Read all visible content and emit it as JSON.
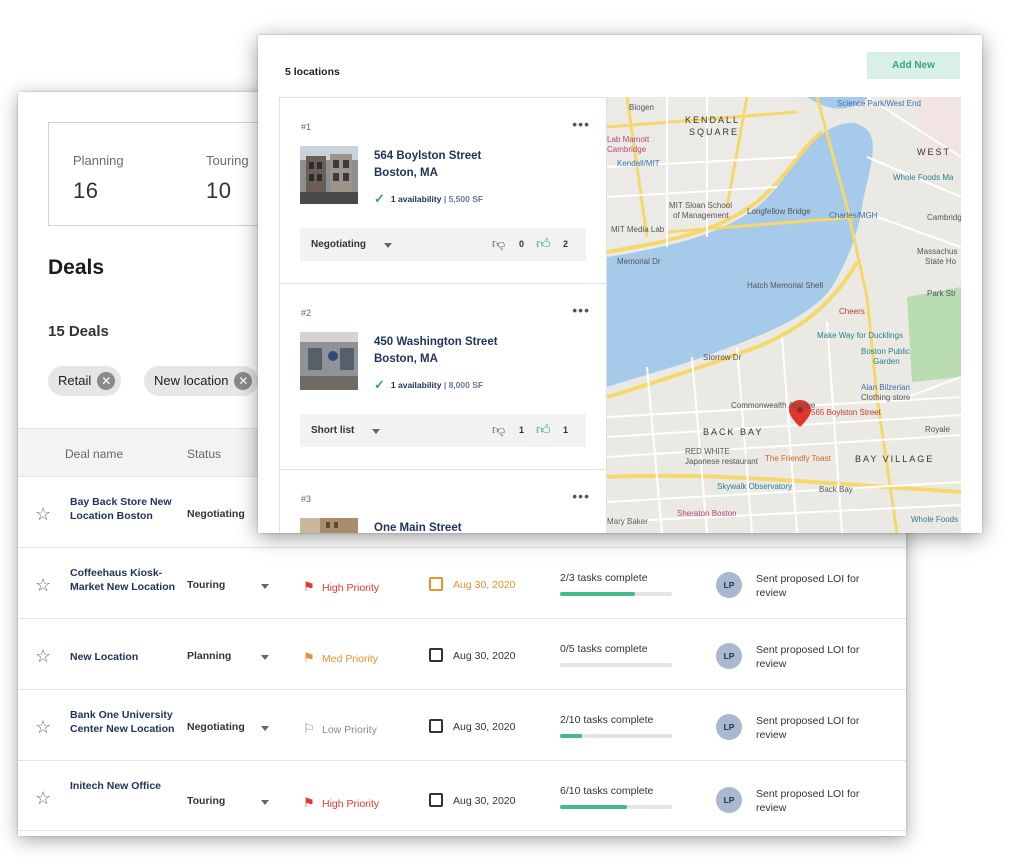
{
  "stats": [
    {
      "label": "Planning",
      "value": "16"
    },
    {
      "label": "Touring",
      "value": "10"
    }
  ],
  "deals": {
    "title": "Deals",
    "count": "15 Deals",
    "filters": [
      "Retail",
      "New location"
    ],
    "columns": {
      "name": "Deal name",
      "status": "Status"
    },
    "rows": [
      {
        "name": "Bay Back Store New Location Boston",
        "status": "Negotiating",
        "priority": "",
        "date": "",
        "tasks": "",
        "progress": 0,
        "assignee": "",
        "note": ""
      },
      {
        "name": "Coffeehaus Kiosk- Market New Location",
        "status": "Touring",
        "priority": "High Priority",
        "priority_color": "#e03a2f",
        "date": "Aug 30, 2020",
        "date_style": "orange",
        "tasks": "2/3 tasks complete",
        "progress": 0.667,
        "assignee": "LP",
        "note": "Sent proposed LOI for review"
      },
      {
        "name": "New Location",
        "status": "Planning",
        "priority": "Med Priority",
        "priority_color": "#e8922b",
        "date": "Aug 30, 2020",
        "date_style": "",
        "tasks": "0/5 tasks complete",
        "progress": 0,
        "assignee": "LP",
        "note": "Sent proposed LOI for review"
      },
      {
        "name": "Bank One University Center New Location",
        "status": "Negotiating",
        "priority": "Low Priority",
        "priority_color": "#8a8a8a",
        "date": "Aug 30, 2020",
        "date_style": "",
        "tasks": "2/10 tasks complete",
        "progress": 0.2,
        "assignee": "LP",
        "note": "Sent proposed LOI for review"
      },
      {
        "name": "Initech New Office",
        "status": "Touring",
        "priority": "High Priority",
        "priority_color": "#e03a2f",
        "date": "Aug 30, 2020",
        "date_style": "",
        "tasks": "6/10 tasks complete",
        "progress": 0.6,
        "assignee": "LP",
        "note": "Sent proposed LOI for review"
      }
    ]
  },
  "locations": {
    "count": "5 locations",
    "add_label": "Add New",
    "items": [
      {
        "index": "#1",
        "street": "564 Boylston Street",
        "city": "Boston, MA",
        "availability": "1 availability",
        "size": "5,500 SF",
        "status": "Negotiating",
        "dislikes": "0",
        "likes": "2"
      },
      {
        "index": "#2",
        "street": "450 Washington Street",
        "city": "Boston, MA",
        "availability": "1 availability",
        "size": "8,000 SF",
        "status": "Short list",
        "dislikes": "1",
        "likes": "1"
      },
      {
        "index": "#3",
        "street": "One Main Street",
        "city": "",
        "availability": "",
        "size": "",
        "status": "",
        "dislikes": "",
        "likes": ""
      }
    ]
  },
  "map": {
    "labels": [
      "Biogen",
      "KENDALL",
      "SQUARE",
      "Science Park/West End",
      "Kendall/MIT",
      "WEST",
      "Whole Foods Ma",
      "MIT Sloan School",
      "of Management",
      "MIT Media Lab",
      "Longfellow Bridge",
      "Charles/MGH",
      "Cambridge",
      "Massachus",
      "State Ho",
      "Park Str",
      "Hatch Memorial Shell",
      "Cheers",
      "Make Way for Ducklings",
      "Boston Public",
      "Garden",
      "Storrow Dr",
      "Alan Bilzerian",
      "Clothing store",
      "565 Boylston Street",
      "BACK BAY",
      "Royale",
      "RED WHITE",
      "Japanese restaurant",
      "The Friendly Toast",
      "BAY VILLAGE",
      "Skywalk Observatory",
      "Back Bay",
      "Sheraton Boston",
      "Whole Foods M",
      "Mary Baker",
      "Commonwealth Avenue",
      "Memorial Dr",
      "Lab Mamott",
      "Cambridge"
    ]
  }
}
